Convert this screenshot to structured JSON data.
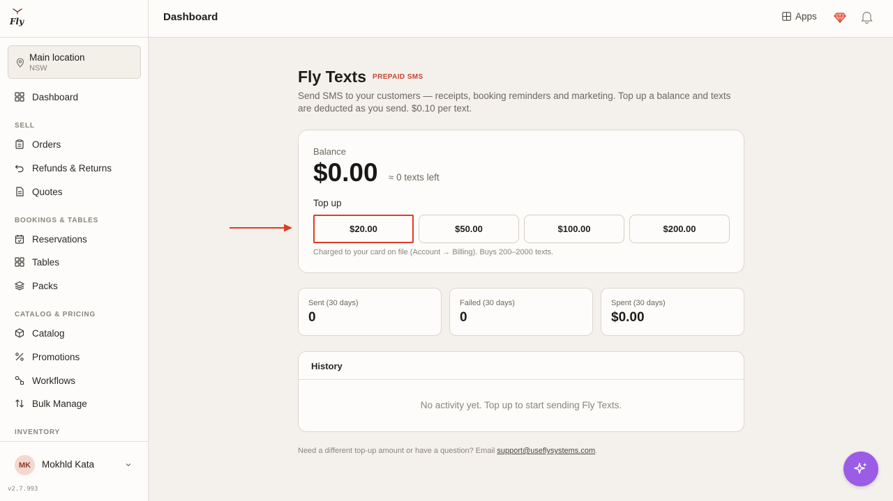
{
  "app": {
    "logo_text": "Fly",
    "version": "v2.7.993"
  },
  "location": {
    "name": "Main location",
    "region": "NSW"
  },
  "sidebar": {
    "dashboard": "Dashboard",
    "sections": {
      "sell": "SELL",
      "bookings": "BOOKINGS & TABLES",
      "catalog": "CATALOG & PRICING",
      "inventory": "INVENTORY"
    },
    "items": {
      "orders": "Orders",
      "refunds": "Refunds & Returns",
      "quotes": "Quotes",
      "reservations": "Reservations",
      "tables": "Tables",
      "packs": "Packs",
      "catalog": "Catalog",
      "promotions": "Promotions",
      "workflows": "Workflows",
      "bulk_manage": "Bulk Manage"
    }
  },
  "user": {
    "initials": "MK",
    "name": "Mokhld Kata"
  },
  "header": {
    "title": "Dashboard",
    "apps_label": "Apps"
  },
  "page": {
    "title": "Fly Texts",
    "badge": "PREPAID SMS",
    "description": "Send SMS to your customers — receipts, booking reminders and marketing. Top up a balance and texts are deducted as you send. $0.10 per text."
  },
  "balance": {
    "label": "Balance",
    "amount": "$0.00",
    "texts_left": "≈ 0 texts left",
    "topup_label": "Top up",
    "options": [
      "$20.00",
      "$50.00",
      "$100.00",
      "$200.00"
    ],
    "selected_index": 0,
    "note": "Charged to your card on file (Account → Billing). Buys 200–2000 texts."
  },
  "stats": [
    {
      "label": "Sent (30 days)",
      "value": "0"
    },
    {
      "label": "Failed (30 days)",
      "value": "0"
    },
    {
      "label": "Spent (30 days)",
      "value": "$0.00"
    }
  ],
  "history": {
    "title": "History",
    "empty": "No activity yet. Top up to start sending Fly Texts."
  },
  "footer": {
    "text": "Need a different top-up amount or have a question? Email ",
    "email": "support@useflysystems.com",
    "end": "."
  },
  "colors": {
    "accent": "#e03c22",
    "badge": "#c6452f",
    "fab": "#9b5de5"
  }
}
